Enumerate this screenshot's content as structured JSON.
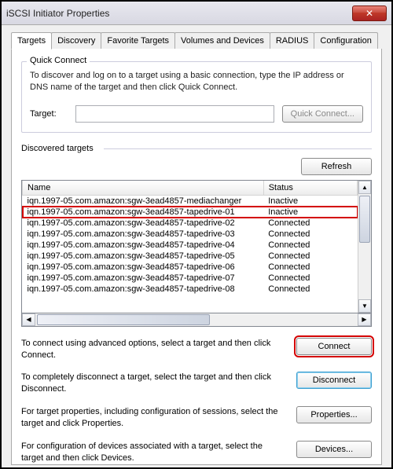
{
  "window": {
    "title": "iSCSI Initiator Properties"
  },
  "tabs": [
    "Targets",
    "Discovery",
    "Favorite Targets",
    "Volumes and Devices",
    "RADIUS",
    "Configuration"
  ],
  "active_tab_index": 0,
  "quick_connect": {
    "group_label": "Quick Connect",
    "description": "To discover and log on to a target using a basic connection, type the IP address or DNS name of the target and then click Quick Connect.",
    "target_label": "Target:",
    "target_value": "",
    "button": "Quick Connect..."
  },
  "discovered": {
    "label": "Discovered targets",
    "refresh": "Refresh",
    "columns": [
      "Name",
      "Status"
    ],
    "rows": [
      {
        "name": "iqn.1997-05.com.amazon:sgw-3ead4857-mediachanger",
        "status": "Inactive",
        "highlight": false
      },
      {
        "name": "iqn.1997-05.com.amazon:sgw-3ead4857-tapedrive-01",
        "status": "Inactive",
        "highlight": true
      },
      {
        "name": "iqn.1997-05.com.amazon:sgw-3ead4857-tapedrive-02",
        "status": "Connected",
        "highlight": false
      },
      {
        "name": "iqn.1997-05.com.amazon:sgw-3ead4857-tapedrive-03",
        "status": "Connected",
        "highlight": false
      },
      {
        "name": "iqn.1997-05.com.amazon:sgw-3ead4857-tapedrive-04",
        "status": "Connected",
        "highlight": false
      },
      {
        "name": "iqn.1997-05.com.amazon:sgw-3ead4857-tapedrive-05",
        "status": "Connected",
        "highlight": false
      },
      {
        "name": "iqn.1997-05.com.amazon:sgw-3ead4857-tapedrive-06",
        "status": "Connected",
        "highlight": false
      },
      {
        "name": "iqn.1997-05.com.amazon:sgw-3ead4857-tapedrive-07",
        "status": "Connected",
        "highlight": false
      },
      {
        "name": "iqn.1997-05.com.amazon:sgw-3ead4857-tapedrive-08",
        "status": "Connected",
        "highlight": false
      }
    ]
  },
  "actions": {
    "connect": {
      "text": "To connect using advanced options, select a target and then click Connect.",
      "button": "Connect"
    },
    "disconnect": {
      "text": "To completely disconnect a target, select the target and then click Disconnect.",
      "button": "Disconnect"
    },
    "properties": {
      "text": "For target properties, including configuration of sessions, select the target and click Properties.",
      "button": "Properties..."
    },
    "devices": {
      "text": "For configuration of devices associated with a target, select the target and then click Devices.",
      "button": "Devices..."
    }
  }
}
